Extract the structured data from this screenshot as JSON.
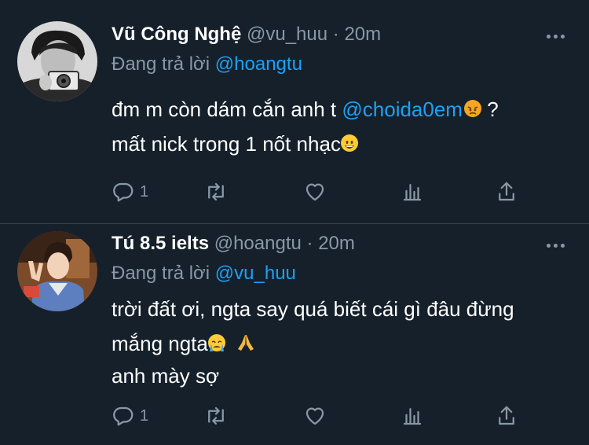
{
  "tweets": [
    {
      "display_name": "Vũ Công Nghệ",
      "handle": "@vu_huu",
      "separator": "·",
      "time": "20m",
      "replying_prefix": "Đang trả lời",
      "replying_to": "@hoangtu",
      "line1_pre": "đm m còn dám cắn anh t ",
      "line1_mention": "@choida0em",
      "line1_post": " ?",
      "line2": "mất nick trong 1 nốt nhạc",
      "reply_count": "1"
    },
    {
      "display_name": "Tú 8.5 ielts",
      "handle": "@hoangtu",
      "separator": "·",
      "time": "20m",
      "replying_prefix": "Đang trả lời",
      "replying_to": "@vu_huu",
      "line1": "trời đất ơi, ngta say quá biết cái gì đâu đừng",
      "line2": "mắng ngta",
      "line3": "anh mày sợ",
      "reply_count": "1"
    }
  ],
  "icons": {
    "reply": "reply-icon",
    "retweet": "retweet-icon",
    "like": "heart-icon",
    "stats": "analytics-icon",
    "share": "share-icon",
    "more": "more-icon"
  },
  "colors": {
    "background": "#15202b",
    "secondary_text": "#8899a6",
    "link": "#1da1f2",
    "divider": "#38444d"
  }
}
